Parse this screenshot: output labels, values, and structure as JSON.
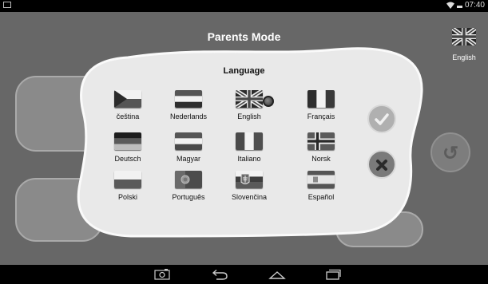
{
  "status_bar": {
    "time": "07:40",
    "left_icon": "screenshot-notification-icon",
    "wifi_icon": "wifi-icon",
    "battery_icon": "battery-icon"
  },
  "header": {
    "title": "Parents Mode",
    "current_language_label": "English",
    "current_language_flag": "uk-flag-icon"
  },
  "dialog": {
    "title": "Language",
    "selected": "English",
    "languages": [
      {
        "name": "čeština",
        "flag": "czech-flag-icon"
      },
      {
        "name": "Nederlands",
        "flag": "dutch-flag-icon"
      },
      {
        "name": "English",
        "flag": "uk-flag-icon"
      },
      {
        "name": "Français",
        "flag": "french-flag-icon"
      },
      {
        "name": "Deutsch",
        "flag": "german-flag-icon"
      },
      {
        "name": "Magyar",
        "flag": "hungarian-flag-icon"
      },
      {
        "name": "Italiano",
        "flag": "italian-flag-icon"
      },
      {
        "name": "Norsk",
        "flag": "norwegian-flag-icon"
      },
      {
        "name": "Polski",
        "flag": "polish-flag-icon"
      },
      {
        "name": "Português",
        "flag": "portuguese-flag-icon"
      },
      {
        "name": "Slovenčina",
        "flag": "slovak-flag-icon"
      },
      {
        "name": "Español",
        "flag": "spanish-flag-icon"
      }
    ],
    "confirm_icon": "checkmark-icon",
    "cancel_icon": "close-icon"
  },
  "navigation": {
    "screenshot_icon": "camera-icon",
    "back_icon": "back-icon",
    "home_icon": "home-icon",
    "recents_icon": "recent-apps-icon"
  }
}
